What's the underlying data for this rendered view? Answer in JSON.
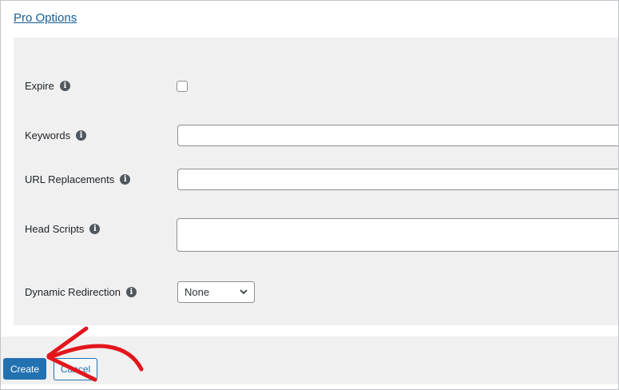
{
  "section": {
    "title": "Pro Options"
  },
  "fields": {
    "expire": {
      "label": "Expire",
      "checked": false
    },
    "keywords": {
      "label": "Keywords",
      "value": ""
    },
    "url_replacements": {
      "label": "URL Replacements",
      "value": ""
    },
    "head_scripts": {
      "label": "Head Scripts",
      "value": ""
    },
    "dynamic_redirection": {
      "label": "Dynamic Redirection",
      "selected": "None"
    }
  },
  "icons": {
    "info": "info-icon",
    "dropdown": "chevron-down-icon",
    "annotation": "red-arrow-annotation"
  },
  "buttons": {
    "create": "Create",
    "cancel": "Cancel"
  },
  "colors": {
    "link": "#135e96",
    "primary": "#2271b1",
    "panel_bg": "#f0f0f1",
    "annotation": "#e3161c"
  }
}
